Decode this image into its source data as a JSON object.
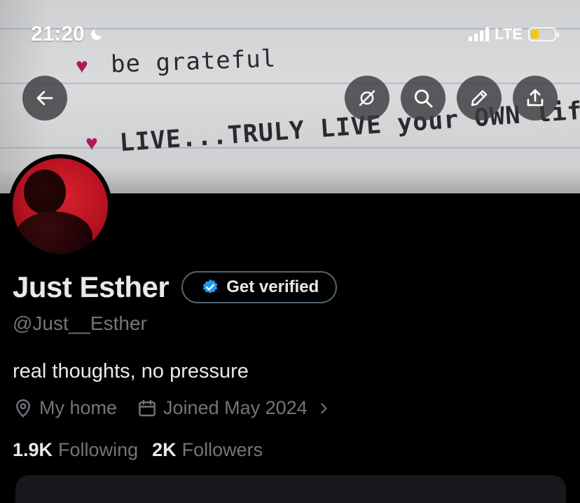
{
  "status_bar": {
    "time": "21:20",
    "network": "LTE",
    "battery_level": 0.35,
    "moon_icon": "moon-icon"
  },
  "banner": {
    "line1": "be grateful",
    "line2": "LIVE...TRULY LIVE your OWN life!",
    "heart_color": "#b0175b"
  },
  "actions": {
    "back_icon": "arrow-left-icon",
    "hide_icon": "eye-slash-icon",
    "search_icon": "search-icon",
    "edit_icon": "pencil-icon",
    "share_icon": "share-icon"
  },
  "profile": {
    "name": "Just Esther",
    "verify_label": "Get verified",
    "handle": "@Just__Esther",
    "bio": "real thoughts, no pressure",
    "location": "My home",
    "joined": "Joined May 2024",
    "following_count": "1.9K",
    "following_label": "Following",
    "followers_count": "2K",
    "followers_label": "Followers"
  },
  "colors": {
    "verified_blue": "#1d9bf0",
    "muted": "#71767b",
    "text": "#e7e9ea",
    "background": "#000000"
  }
}
